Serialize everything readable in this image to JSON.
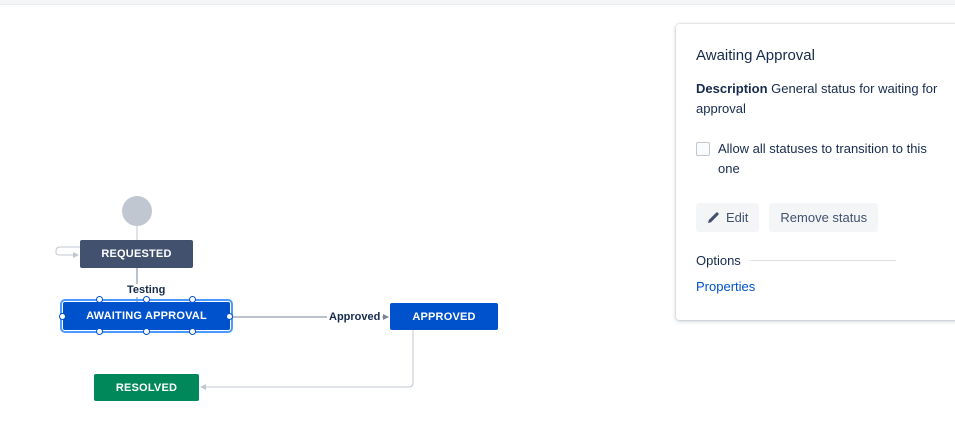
{
  "workflow": {
    "nodes": {
      "requested": "REQUESTED",
      "awaiting": "AWAITING APPROVAL",
      "approved": "APPROVED",
      "resolved": "RESOLVED"
    },
    "transitions": {
      "testing": "Testing",
      "approved": "Approved"
    },
    "colors": {
      "requested": "#42526e",
      "in_progress": "#0052cc",
      "done": "#00875a"
    }
  },
  "panel": {
    "title": "Awaiting Approval",
    "description_label": "Description",
    "description_text": "General status for waiting for approval",
    "checkbox_label": "Allow all statuses to transition to this one",
    "checkbox_checked": false,
    "edit_button": "Edit",
    "remove_button": "Remove status",
    "options_title": "Options",
    "properties_link": "Properties"
  }
}
